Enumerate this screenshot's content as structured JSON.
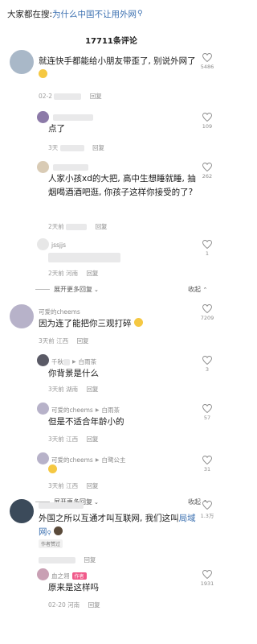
{
  "search": {
    "prefix": "大家都在搜:",
    "query": "为什么中国不让用外网",
    "icon": "search-icon"
  },
  "comment_count": "17711条评论",
  "comments": [
    {
      "text": "就连快手都能给小朋友带歪了, 别说外网了",
      "time": "02-2",
      "reply": "回复",
      "likes": "5486"
    },
    {
      "text": "点了",
      "time": "3天",
      "reply": "回复",
      "likes": "109"
    },
    {
      "text": "人家小孩xd的大把, 高中生想睡就睡, 抽烟喝酒酒吧逛, 你孩子这样你接受的了?",
      "time": "2天前",
      "reply": "回复",
      "likes": "262"
    },
    {
      "user": "jssjjs",
      "time": "2天前",
      "location": "河南",
      "reply": "回复",
      "likes": "1"
    }
  ],
  "expand1": {
    "expand": "展开更多回复",
    "collapse": "收起"
  },
  "thread2": {
    "user": "可爱的cheems",
    "text": "因为连了能把你三观打碎",
    "time": "3天前",
    "location": "江西",
    "reply": "回复",
    "likes": "7209",
    "replies": [
      {
        "user": "千秋",
        "to": "白雨茶",
        "text": "你背景是什么",
        "time": "3天前",
        "location": "湖南",
        "reply": "回复",
        "likes": "3"
      },
      {
        "user": "可爱的cheems",
        "to": "白雨茶",
        "text": "但是不适合年龄小的",
        "time": "3天前",
        "location": "江西",
        "reply": "回复",
        "likes": "57"
      },
      {
        "user": "可爱的cheems",
        "to": "白鹭公主",
        "text": "",
        "time": "3天前",
        "location": "江西",
        "reply": "回复",
        "likes": "31"
      }
    ]
  },
  "expand2": {
    "expand": "展开更多回复",
    "collapse": "收起"
  },
  "thread3": {
    "text_a": "外国之所以互通才叫互联网, 我们这叫",
    "text_b": "局域网",
    "author_liked": "作者赞过",
    "reply": "回复",
    "likes": "1.3万",
    "sub": {
      "user": "血之翎",
      "author_tag": "作者",
      "text": "原来是这样吗",
      "time": "02-20",
      "location": "河南",
      "reply": "回复",
      "likes": "1931"
    }
  },
  "colors": {
    "link": "#3a6fb0",
    "author_tag": "#f05a8a"
  }
}
